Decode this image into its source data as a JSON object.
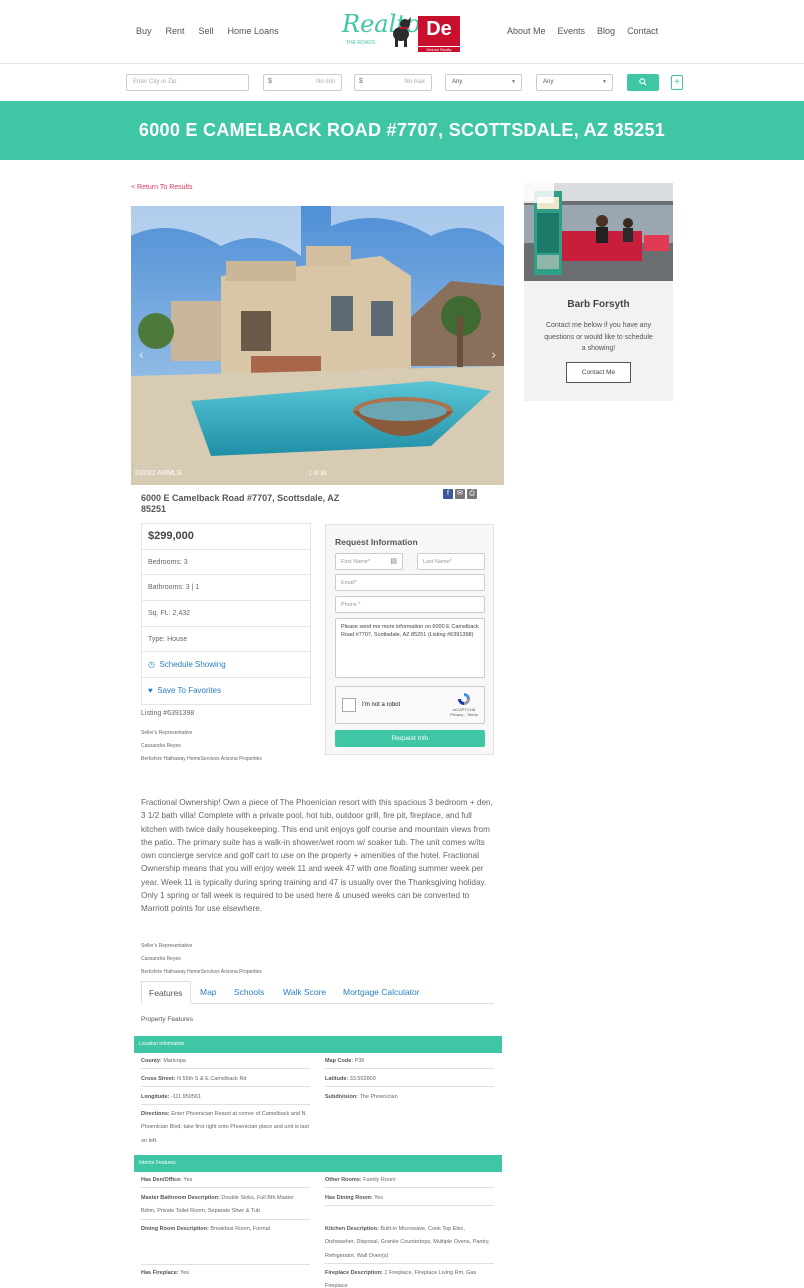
{
  "nav": {
    "left": [
      "Buy",
      "Rent",
      "Sell",
      "Home Loans"
    ],
    "right": [
      "About Me",
      "Events",
      "Blog",
      "Contact"
    ]
  },
  "logo": {
    "text": "Realtor",
    "sub": "THE ROADS",
    "brand": "De",
    "brand_sub": "Deluxe Realty"
  },
  "search": {
    "city_placeholder": "Enter City or Zip",
    "min_placeholder": "No min",
    "max_placeholder": "No max",
    "currency": "$",
    "beds": "Any",
    "baths": "Any",
    "plus": "+"
  },
  "title": "6000 E CAMELBACK ROAD #7707, SCOTTSDALE, AZ 85251",
  "back_link": "< Return To Results",
  "photo": {
    "watermark": "©2022 ARMLS",
    "counter": "1 of 38"
  },
  "address": "6000 E Camelback Road #7707, Scottsdale, AZ 85251",
  "facts": {
    "price": "$299,000",
    "bedrooms": "Bedrooms: 3",
    "bathrooms": "Bathrooms: 3 | 1",
    "sqft": "Sq. Ft.: 2,432",
    "type": "Type: House",
    "schedule": "Schedule Showing",
    "favorite": "Save To Favorites"
  },
  "listing_no": "Listing #6391398",
  "seller": {
    "label": "Seller's Representative",
    "name": "Cassandra Reyes",
    "brokerage": "Berkshire Hathaway HomeServices Arizona Properties"
  },
  "form": {
    "title": "Request Information",
    "first": "First Name*",
    "last": "Last Name*",
    "email": "Email*",
    "phone": "Phone *",
    "message": "Please send me more information on 6000 E Camelback Road #7707, Scottsdale, AZ 85251 (Listing #6391398)",
    "captcha_label": "I'm not a robot",
    "captcha_brand": "reCAPTCHA",
    "captcha_terms": "Privacy - Terms",
    "submit": "Request Info"
  },
  "agent": {
    "name": "Barb Forsyth",
    "text": "Contact me below if you have any questions or would like to schedule a showing!",
    "button": "Contact Me"
  },
  "description": "Fractional Ownership! Own a piece of The Phoenician resort with this spacious 3 bedroom + den, 3 1/2 bath villa! Complete with a private pool, hot tub, outdoor grill, fire pit, fireplace, and full kitchen with twice daily housekeeping. This end unit enjoys golf course and mountain views from the patio. The primary suite has a walk-in shower/wet room w/ soaker tub. The unit comes w/its own concierge service and golf cart to use on the property + amenities of the hotel. Fractional Ownership means that you will enjoy week 11 and week 47 with one floating summer week per year. Week 11 is typically during spring training and 47 is usually over the Thanksgiving holiday. Only 1 spring or fall week is required to be used here & unused weeks can be converted to Marriott points for use elsewhere.",
  "tabs": [
    "Features",
    "Map",
    "Schools",
    "Walk Score",
    "Mortgage Calculator"
  ],
  "property_features": "Property Features",
  "location": {
    "header": "Location Information",
    "county_k": "County:",
    "county_v": "Maricopa",
    "mapcode_k": "Map Code:",
    "mapcode_v": "P36",
    "cross_k": "Cross Street:",
    "cross_v": "N 56th S & E Camelback Rd",
    "lat_k": "Latitude:",
    "lat_v": "33.502809",
    "lon_k": "Longitude:",
    "lon_v": "-111.950561",
    "subdiv_k": "Subdivision:",
    "subdiv_v": "The Phoenician",
    "dir_k": "Directions:",
    "dir_v": "Enter Phoenician Resort at corner of Camelback and N. Phoenician Blvd, take first right onto Phoenician place and unit is last on left."
  },
  "interior": {
    "header": "Interior Features",
    "den_k": "Has Den/Office:",
    "den_v": "Yes",
    "other_k": "Other Rooms:",
    "other_v": "Family Room",
    "mbath_k": "Master Bathroom Description:",
    "mbath_v": "Double Sinks, Full Bth Master Bdrm, Private Toilet Room, Separate Shwr & Tub",
    "dining_k": "Has Dining Room:",
    "dining_v": "Yes",
    "diningdesc_k": "Dining Room Description:",
    "diningdesc_v": "Breakfast Room, Formal",
    "kitchen_k": "Kitchen Description:",
    "kitchen_v": "Built-in Microwave, Cook Top Elec, Dishwasher, Disposal, Granite Countertops, Multiple Ovens, Pantry, Refrigerator, Wall Oven(s)",
    "fire_k": "Has Fireplace:",
    "fire_v": "Yes",
    "firedesc_k": "Fireplace Description:",
    "firedesc_v": "1 Fireplace, Fireplace Living Rm, Gas Fireplace"
  },
  "colors": {
    "accent": "#3fc6a5",
    "link": "#2a7fc1",
    "back_link": "#d23b5c",
    "brand_red": "#c8102e"
  }
}
